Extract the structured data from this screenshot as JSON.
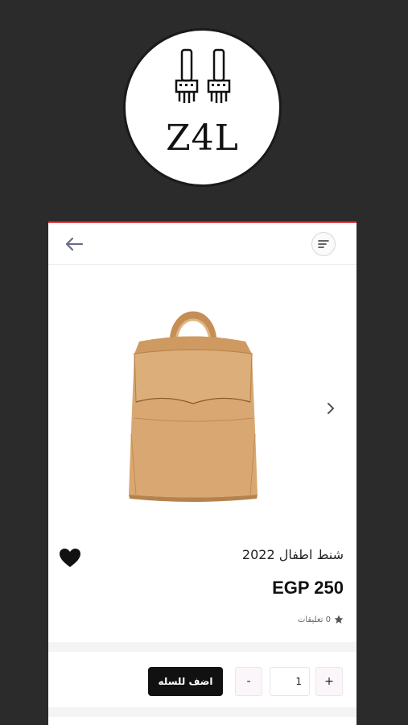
{
  "brand": {
    "logo_text": "Z4L"
  },
  "topbar": {
    "back_icon": "arrow-left-icon",
    "menu_icon": "menu-lines-icon"
  },
  "product": {
    "title": "شنط اطفال 2022",
    "price": "EGP 250",
    "reviews_label": "0 تعليقات",
    "image_icon": "backpack-image",
    "colors": {
      "bag": "#d9a872",
      "accent": "#e0474c"
    }
  },
  "cart": {
    "add_label": "اضف للسله",
    "minus_label": "-",
    "plus_label": "+",
    "quantity": "1"
  }
}
